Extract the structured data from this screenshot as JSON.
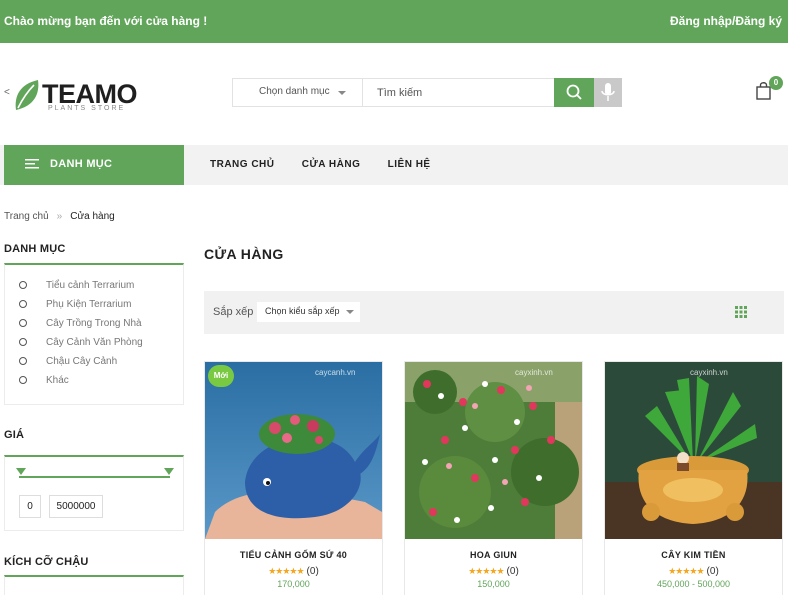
{
  "topbar": {
    "welcome": "Chào mừng bạn đến với cửa hàng !",
    "login": "Đăng nhập/Đăng ký"
  },
  "logo": {
    "prefix": "<",
    "brand": "TEAMO",
    "tagline": "PLANTS STORE"
  },
  "search": {
    "category": "Chọn danh mục",
    "placeholder": "Tìm kiếm",
    "icon": "search-icon",
    "mic_icon": "microphone-icon"
  },
  "cart": {
    "count": "0",
    "icon": "shopping-bag-icon"
  },
  "nav": {
    "danhmuc": "DANH MỤC",
    "items": [
      "TRANG CHỦ",
      "CỬA HÀNG",
      "LIÊN HỆ"
    ]
  },
  "breadcrumb": {
    "home": "Trang chủ",
    "sep": "»",
    "current": "Cửa hàng"
  },
  "sidebar": {
    "categories_title": "DANH MỤC",
    "categories": [
      "Tiểu cảnh Terrarium",
      "Phụ Kiện Terrarium",
      "Cây Trồng Trong Nhà",
      "Cây Cảnh Văn Phòng",
      "Chậu Cây Cảnh",
      "Khác"
    ],
    "price_title": "GIÁ",
    "price_min": "0",
    "price_max": "5000000",
    "size_title": "KÍCH CỠ CHẬU"
  },
  "main": {
    "title": "CỬA HÀNG",
    "sort_label": "Sắp xếp",
    "sort_select": "Chọn kiểu sắp xếp",
    "products": [
      {
        "name": "TIỂU CẢNH GỐM SỨ 40",
        "rating_count": "(0)",
        "price": "170,000",
        "badge": "Mới",
        "watermark": "caycanh.vn"
      },
      {
        "name": "HOA GIUN",
        "rating_count": "(0)",
        "price": "150,000",
        "watermark": "cayxinh.vn"
      },
      {
        "name": "CÂY KIM TIỀN",
        "rating_count": "(0)",
        "price": "450,000 - 500,000",
        "watermark": "cayxinh.vn"
      }
    ]
  },
  "colors": {
    "primary": "#61a55a",
    "star": "#f3a61e"
  }
}
